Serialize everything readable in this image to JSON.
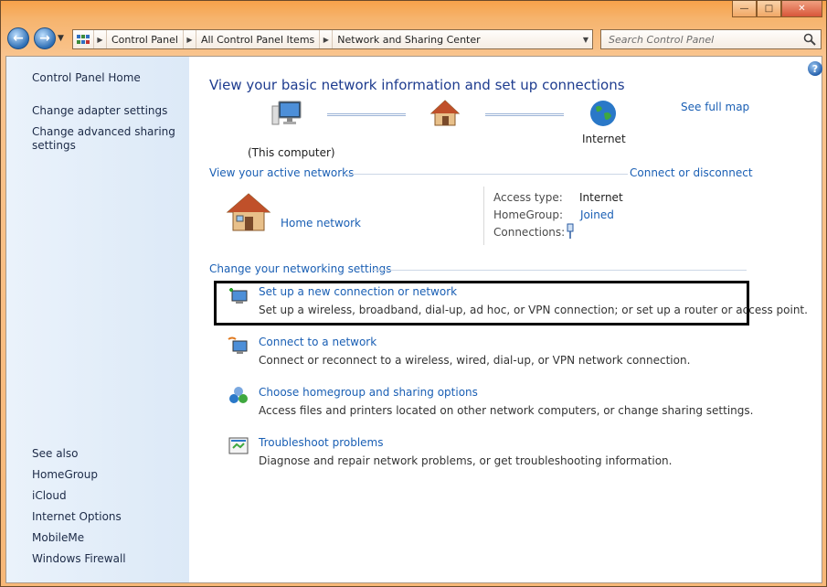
{
  "window": {
    "minimize": "—",
    "maximize": "□",
    "close": "✕"
  },
  "nav": {
    "back": "←",
    "forward": "→",
    "breadcrumbs": [
      "Control Panel",
      "All Control Panel Items",
      "Network and Sharing Center"
    ],
    "search_placeholder": "Search Control Panel"
  },
  "sidebar": {
    "home": "Control Panel Home",
    "links": [
      "Change adapter settings",
      "Change advanced sharing settings"
    ],
    "see_also_title": "See also",
    "see_also": [
      "HomeGroup",
      "iCloud",
      "Internet Options",
      "MobileMe",
      "Windows Firewall"
    ]
  },
  "main": {
    "title": "View your basic network information and set up connections",
    "see_full_map": "See full map",
    "map": {
      "computer_label": "(This computer)",
      "internet_label": "Internet"
    },
    "active_networks": {
      "heading": "View your active networks",
      "connect_link": "Connect or disconnect",
      "network_name": "Home network",
      "access_type_label": "Access type:",
      "access_type_value": "Internet",
      "homegroup_label": "HomeGroup:",
      "homegroup_value": "Joined",
      "connections_label": "Connections:"
    },
    "settings": {
      "heading": "Change your networking settings",
      "tasks": [
        {
          "title": "Set up a new connection or network",
          "desc": "Set up a wireless, broadband, dial-up, ad hoc, or VPN connection; or set up a router or access point."
        },
        {
          "title": "Connect to a network",
          "desc": "Connect or reconnect to a wireless, wired, dial-up, or VPN network connection."
        },
        {
          "title": "Choose homegroup and sharing options",
          "desc": "Access files and printers located on other network computers, or change sharing settings."
        },
        {
          "title": "Troubleshoot problems",
          "desc": "Diagnose and repair network problems, or get troubleshooting information."
        }
      ]
    }
  }
}
